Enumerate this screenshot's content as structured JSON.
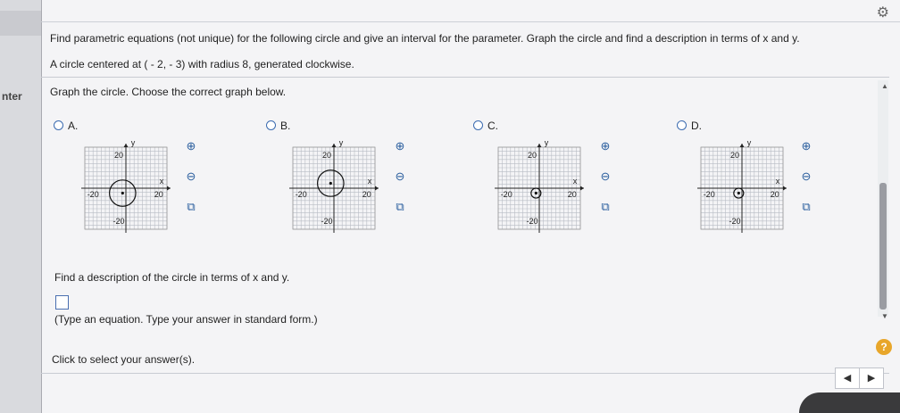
{
  "left_panel": {
    "text": "nter"
  },
  "question": {
    "instruction": "Find parametric equations (not unique) for the following circle and give an interval for the parameter. Graph the circle and find a description in terms of x and y.",
    "given": "A circle centered at ( - 2, - 3) with radius 8, generated clockwise.",
    "graph_prompt": "Graph the circle. Choose the correct graph below.",
    "options": [
      {
        "label": "A.",
        "circle_center": [
          -2,
          -3
        ],
        "circle_radius": 8
      },
      {
        "label": "B.",
        "circle_center": [
          -2,
          3
        ],
        "circle_radius": 8
      },
      {
        "label": "C.",
        "circle_center": [
          -2,
          -3
        ],
        "circle_radius": 3
      },
      {
        "label": "D.",
        "circle_center": [
          -2,
          -3
        ],
        "circle_radius": 3
      }
    ],
    "axis": {
      "pos_label": "20",
      "neg_label": "-20",
      "x_label": "x",
      "y_label": "y"
    },
    "description_prompt": "Find a description of the circle in terms of x and y.",
    "answer_hint": "(Type an equation. Type your answer in standard form.)",
    "click_prompt": "Click to select your answer(s)."
  },
  "icons": {
    "zoom_in": "⊕",
    "zoom_out": "⊖",
    "popout": "⧉",
    "gear": "⚙",
    "help": "?",
    "nav_prev": "◀",
    "nav_next": "▶"
  },
  "colors": {
    "grid": "#b8bcc4",
    "accent": "#3a6ab0",
    "help": "#e8a62a"
  }
}
